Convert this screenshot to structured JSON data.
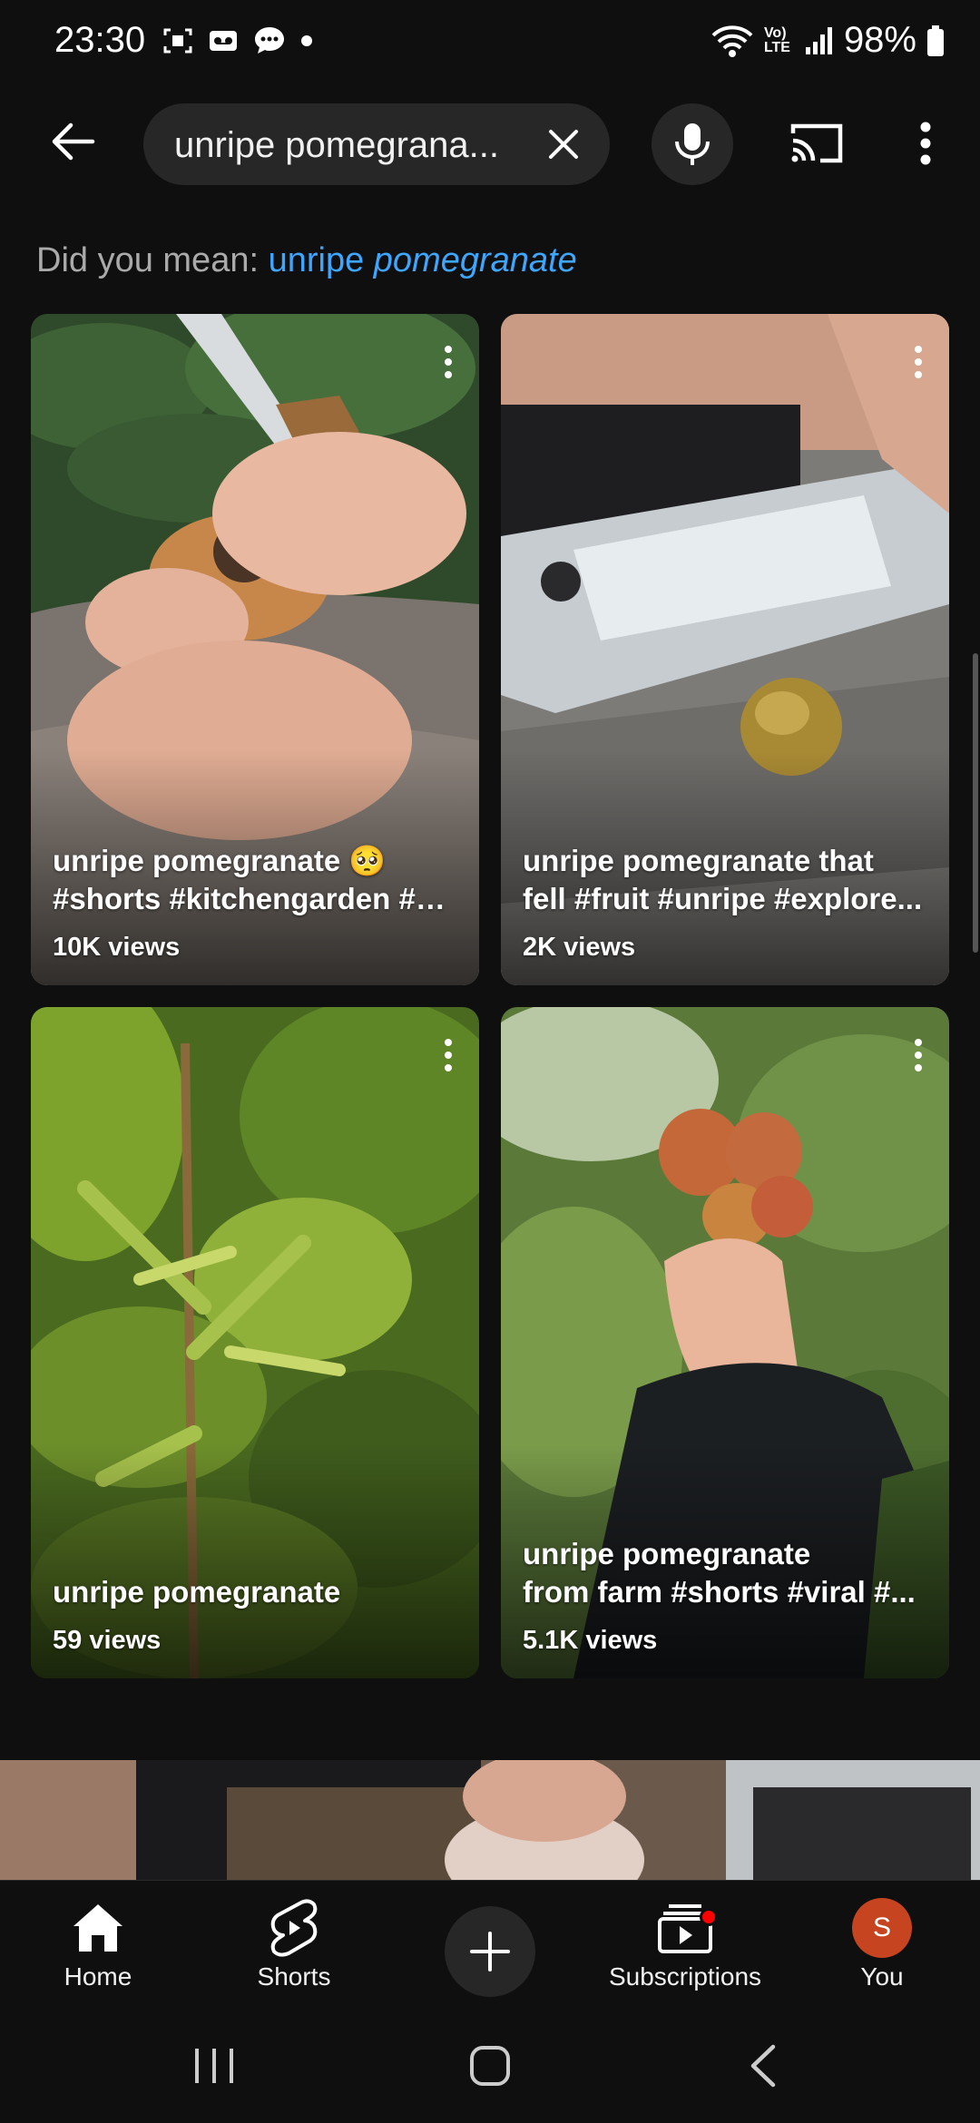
{
  "status_bar": {
    "time": "23:30",
    "network_label": "Vo) LTE",
    "battery": "98%"
  },
  "search": {
    "query": "unripe pomegrana..."
  },
  "did_you_mean": {
    "prefix": "Did you mean: ",
    "suggestion_plain": "unripe ",
    "suggestion_italic": "pomegranate"
  },
  "shorts": [
    {
      "title_line1": "unripe pomegranate 🥺",
      "title_line2": "#shorts #kitchengarden #n...",
      "views": "10K views"
    },
    {
      "title_line1": "unripe pomegranate that",
      "title_line2": "fell #fruit #unripe #explore...",
      "views": "2K views"
    },
    {
      "title_line1": "unripe pomegranate",
      "title_line2": "",
      "views": "59 views"
    },
    {
      "title_line1": "unripe pomegranate",
      "title_line2": "from farm #shorts #viral #...",
      "views": "5.1K views"
    }
  ],
  "bottom_nav": {
    "home": "Home",
    "shorts": "Shorts",
    "subscriptions": "Subscriptions",
    "you": "You",
    "avatar_initial": "S"
  },
  "colors": {
    "background": "#0f0f0f",
    "link": "#3ea6ff",
    "avatar": "#c6441f",
    "notification": "#ff0000"
  },
  "icons": [
    "back-arrow-icon",
    "close-icon",
    "mic-icon",
    "cast-icon",
    "more-vert-icon",
    "home-icon",
    "shorts-icon",
    "plus-icon",
    "subscriptions-icon",
    "recents-icon",
    "home-circle-icon",
    "back-chevron-icon"
  ]
}
